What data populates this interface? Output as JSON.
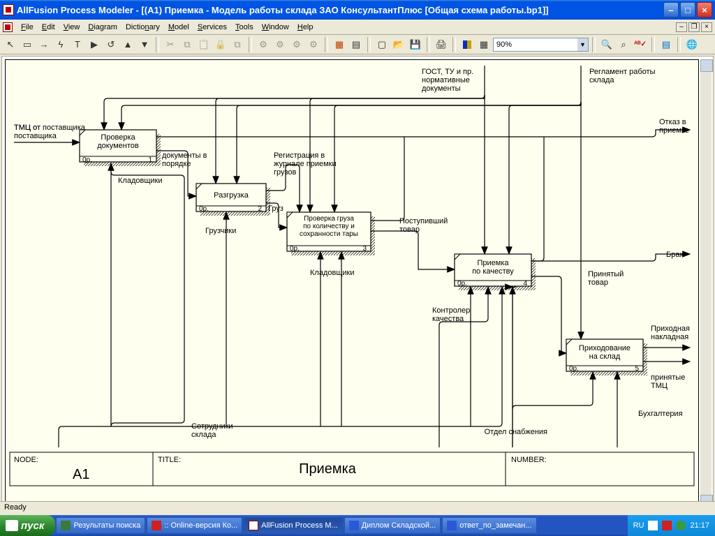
{
  "window": {
    "title": "AllFusion Process Modeler  - [(A1) Приемка - Модель работы склада ЗАО КонсультантПлюс  [Общая схема работы.bp1]]"
  },
  "menu": {
    "items": [
      "File",
      "Edit",
      "View",
      "Diagram",
      "Dictionary",
      "Model",
      "Services",
      "Tools",
      "Window",
      "Help"
    ]
  },
  "toolbar": {
    "zoom_value": "90%"
  },
  "status": {
    "text": "Ready"
  },
  "diagram": {
    "footer": {
      "node_label": "NODE:",
      "node_value": "A1",
      "title_label": "TITLE:",
      "title_value": "Приемка",
      "number_label": "NUMBER:"
    },
    "inputs": {
      "tmc": "ТМЦ от поставщика",
      "gost": "ГОСТ, ТУ и пр. нормативные документы",
      "reglament": "Регламент работы склада"
    },
    "outputs": {
      "otkaz": "Отказ в приемке",
      "brak": "Брак",
      "nakladnaya": "Приходная накладная",
      "tmc": "принятые ТМЦ"
    },
    "mechanisms": {
      "kladov": "Кладовщики",
      "gruz": "Грузчики",
      "sotrud": "Сотрудники склада",
      "kontroler": "Контролер качества",
      "otdel": "Отдел снабжения",
      "buh": "Бухгалтерия"
    },
    "flows": {
      "doc_ok": "документы в порядке",
      "reg": "Регистрация в журнале приемки грузов",
      "gruz": "Груз",
      "post_tovar": "Поступивший товар",
      "prin_tovar": "Принятый товар"
    },
    "boxes": [
      {
        "title": "Проверка документов",
        "op": "0р.",
        "num": "1"
      },
      {
        "title": "Разгрузка",
        "op": "0р.",
        "num": "2"
      },
      {
        "title": "Проверка груза по количеству и сохранности тары",
        "op": "0р.",
        "num": "3"
      },
      {
        "title": "Приемка по качеству",
        "op": "0р.",
        "num": "4"
      },
      {
        "title": "Приходование на склад",
        "op": "0р.",
        "num": "5"
      }
    ]
  },
  "taskbar": {
    "start": "пуск",
    "items": [
      "Результаты поиска",
      ":: Online-версия Ко...",
      "AllFusion Process M...",
      "Диплом Складской...",
      "ответ_по_замечан..."
    ],
    "lang": "RU",
    "time": "21:17"
  }
}
